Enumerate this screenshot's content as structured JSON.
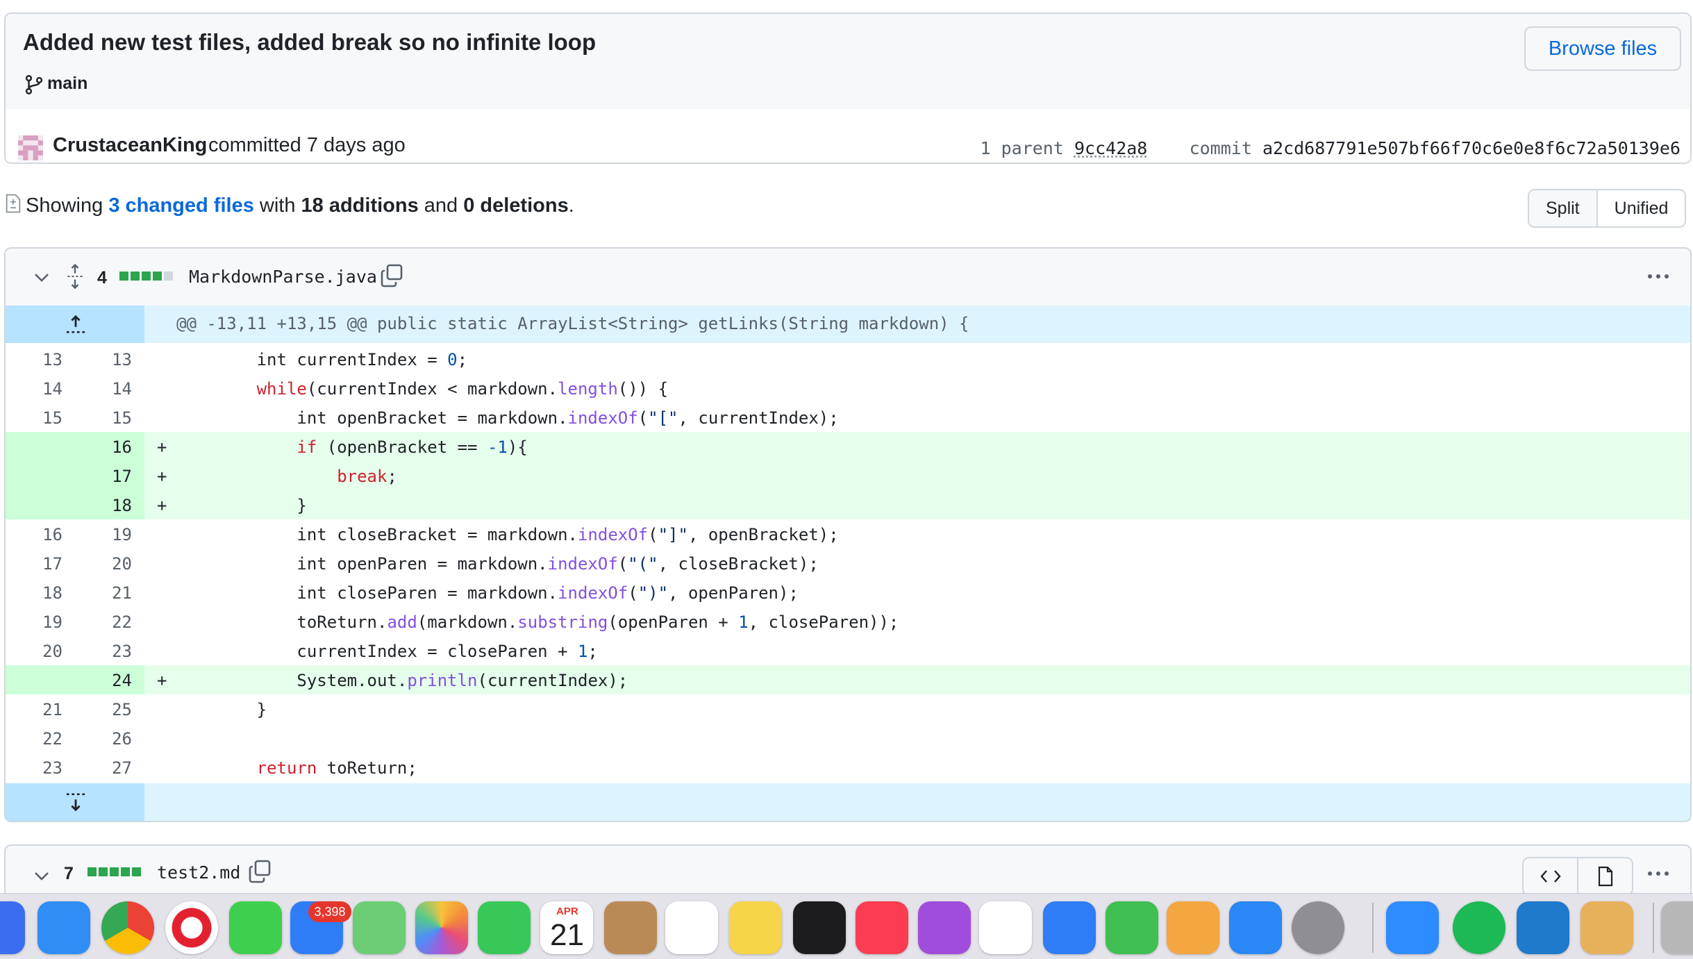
{
  "commit": {
    "title": "Added new test files, added break so no infinite loop",
    "branch": "main",
    "browse_label": "Browse files",
    "author": "CrustaceanKing",
    "committed": "committed 7 days ago",
    "parent_label": "1 parent",
    "parent_sha": "9cc42a8",
    "commit_label": "commit",
    "commit_sha": "a2cd687791e507bf66f70c6e0e8f6c72a50139e6"
  },
  "summary": {
    "showing": "Showing ",
    "changed_files": "3 changed files",
    "with": " with ",
    "additions": "18 additions",
    "and": " and ",
    "deletions": "0 deletions",
    "period": "."
  },
  "view_toggle": {
    "split": "Split",
    "unified": "Unified"
  },
  "file1": {
    "count": "4",
    "name": "MarkdownParse.java",
    "hunk": "@@ -13,11 +13,15 @@ public static ArrayList<String> getLinks(String markdown) {",
    "lines": [
      {
        "old": "13",
        "new": "13",
        "mark": ""
      },
      {
        "old": "14",
        "new": "14",
        "mark": ""
      },
      {
        "old": "15",
        "new": "15",
        "mark": ""
      },
      {
        "old": "",
        "new": "16",
        "mark": "+"
      },
      {
        "old": "",
        "new": "17",
        "mark": "+"
      },
      {
        "old": "",
        "new": "18",
        "mark": "+"
      },
      {
        "old": "16",
        "new": "19",
        "mark": ""
      },
      {
        "old": "17",
        "new": "20",
        "mark": ""
      },
      {
        "old": "18",
        "new": "21",
        "mark": ""
      },
      {
        "old": "19",
        "new": "22",
        "mark": ""
      },
      {
        "old": "20",
        "new": "23",
        "mark": ""
      },
      {
        "old": "",
        "new": "24",
        "mark": "+"
      },
      {
        "old": "21",
        "new": "25",
        "mark": ""
      },
      {
        "old": "22",
        "new": "26",
        "mark": ""
      },
      {
        "old": "23",
        "new": "27",
        "mark": ""
      }
    ],
    "code": {
      "l0": [
        "        int currentIndex = ",
        "0",
        ";"
      ],
      "l1": [
        "        ",
        "while",
        "(currentIndex < markdown.",
        "length",
        "()) {"
      ],
      "l2": [
        "            int openBracket = markdown.",
        "indexOf",
        "(",
        "\"[\"",
        ", currentIndex);"
      ],
      "l3": [
        "            ",
        "if",
        " (openBracket == ",
        "-1",
        "){"
      ],
      "l4": [
        "                ",
        "break",
        ";"
      ],
      "l5": [
        "            }"
      ],
      "l6": [
        "            int closeBracket = markdown.",
        "indexOf",
        "(",
        "\"]\"",
        ", openBracket);"
      ],
      "l7": [
        "            int openParen = markdown.",
        "indexOf",
        "(",
        "\"(\"",
        ", closeBracket);"
      ],
      "l8": [
        "            int closeParen = markdown.",
        "indexOf",
        "(",
        "\")\"",
        ", openParen);"
      ],
      "l9": [
        "            toReturn.",
        "add",
        "(markdown.",
        "substring",
        "(openParen + ",
        "1",
        ", closeParen));"
      ],
      "l10": [
        "            currentIndex = closeParen + ",
        "1",
        ";"
      ],
      "l11": [
        "            System.out.",
        "println",
        "(currentIndex);"
      ],
      "l12": [
        "        }"
      ],
      "l13": [
        ""
      ],
      "l14": [
        "        ",
        "return",
        " toReturn;"
      ]
    }
  },
  "file2": {
    "count": "7",
    "name": "test2.md"
  },
  "dock": {
    "mail_badge": "3,398",
    "calendar_month": "APR",
    "calendar_day": "21",
    "apps": [
      "launchpad-icon",
      "safari-icon",
      "chrome-icon",
      "opera-icon",
      "messages-icon",
      "mail-icon",
      "maps-icon",
      "photos-icon",
      "facetime-icon",
      "calendar-icon",
      "contacts-icon",
      "reminders-icon",
      "notes-icon",
      "apple-tv-icon",
      "music-icon",
      "podcasts-icon",
      "news-icon",
      "keynote-icon",
      "numbers-icon",
      "pages-icon",
      "app-store-icon",
      "system-settings-icon",
      "zoom-icon",
      "spotify-icon",
      "vscode-icon",
      "java-installer-icon",
      "user-thumbnail-icon"
    ]
  },
  "colors": {
    "link": "#0969da",
    "addition_bg": "#e6ffec",
    "addition_gutter": "#ccffd8",
    "hunk_bg": "#ddf4ff",
    "diffstat_green": "#2da44e"
  }
}
